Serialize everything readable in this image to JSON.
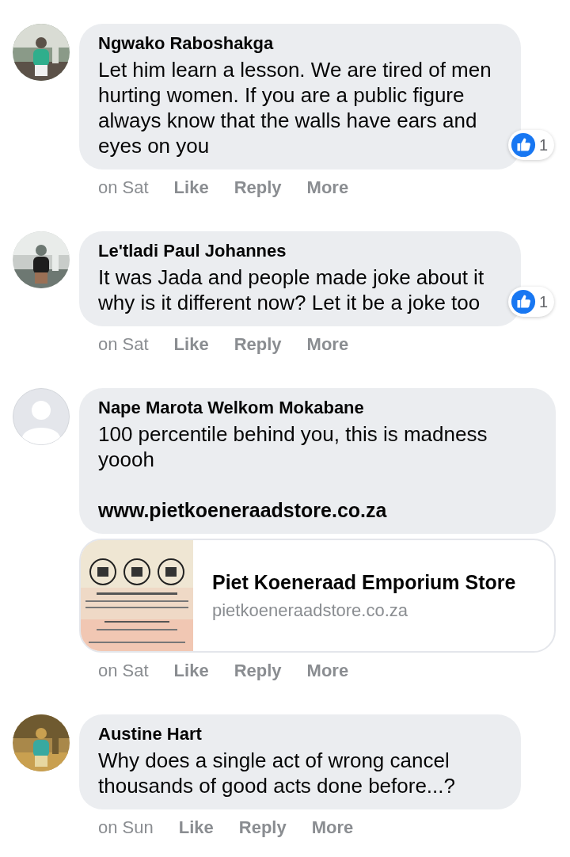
{
  "comments": [
    {
      "author": "Ngwako Raboshakga",
      "text": "Let him learn a lesson. We are tired of men hurting women. If you are a public figure always know that the walls have ears and eyes on you",
      "reactions": "1",
      "actions": [
        "on Sat",
        "Like",
        "Reply",
        "More"
      ]
    },
    {
      "author": "Le'tladi Paul Johannes",
      "text": "It was Jada and people made joke about it why is it different now? Let it be a joke too",
      "reactions": "1",
      "actions": [
        "on Sat",
        "Like",
        "Reply",
        "More"
      ]
    },
    {
      "author": "Nape Marota Welkom Mokabane",
      "avatar": {
        "kind": "default"
      },
      "text": "100 percentile behind you, this is madness yoooh",
      "link": "www.pietkoeneraadstore.co.za",
      "preview": {
        "title": "Piet Koeneraad Emporium Store",
        "domain": "pietkoeneraadstore.co.za"
      },
      "actions": [
        "on Sat",
        "Like",
        "Reply",
        "More"
      ]
    },
    {
      "author": "Austine Hart",
      "text": "Why does a single act of wrong cancel thousands of good acts done before...?",
      "actions": [
        "on Sun",
        "Like",
        "Reply",
        "More"
      ]
    }
  ]
}
